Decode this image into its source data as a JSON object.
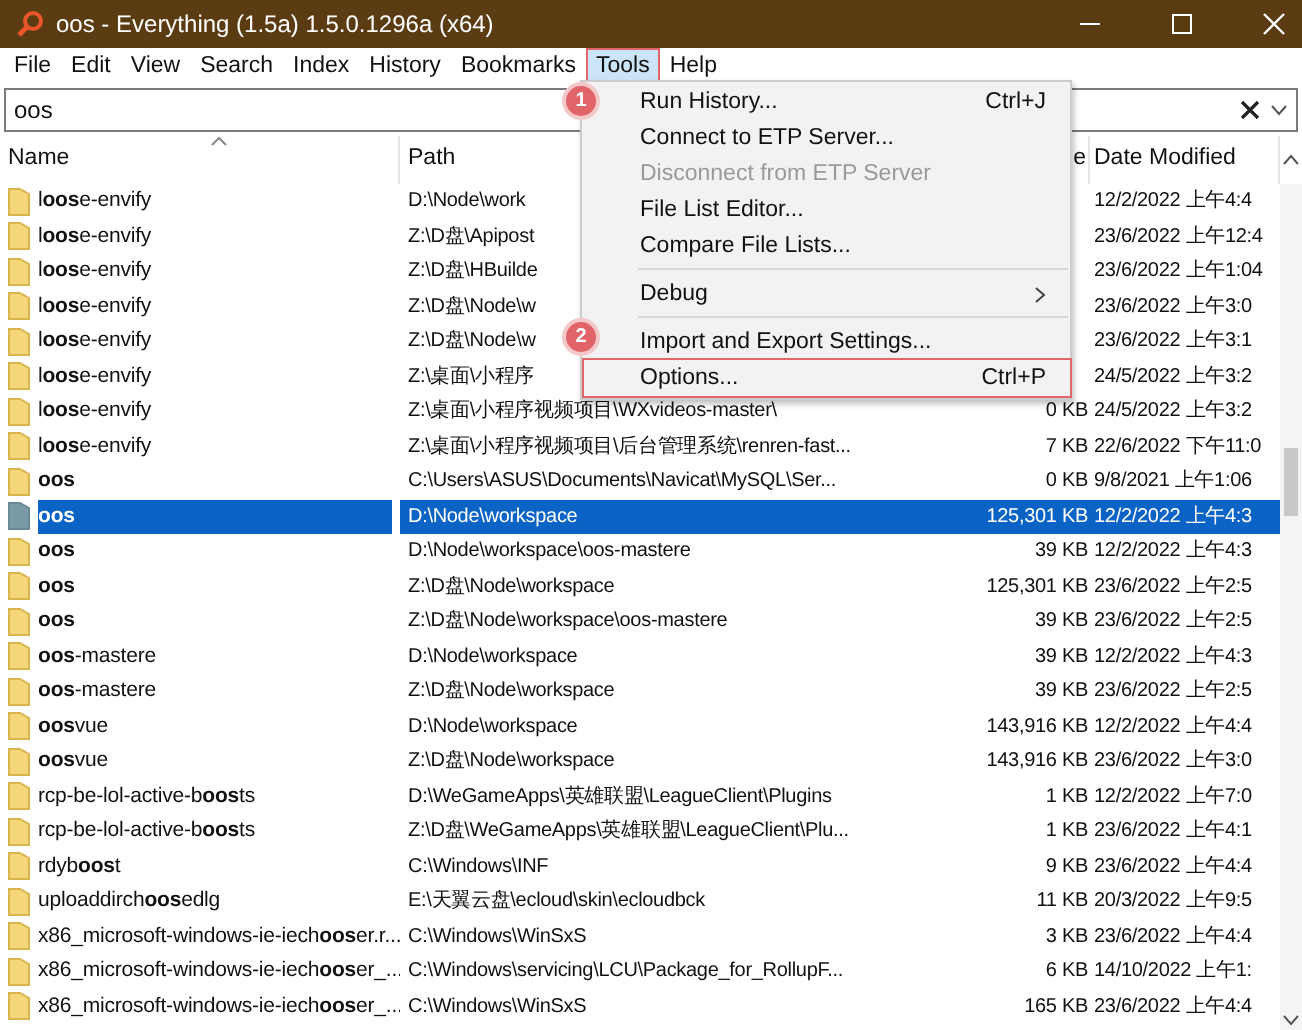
{
  "window": {
    "title": "oos - Everything (1.5a) 1.5.0.1296a (x64)"
  },
  "menu_bar": [
    {
      "label": "File",
      "selected": false
    },
    {
      "label": "Edit",
      "selected": false
    },
    {
      "label": "View",
      "selected": false
    },
    {
      "label": "Search",
      "selected": false
    },
    {
      "label": "Index",
      "selected": false
    },
    {
      "label": "History",
      "selected": false
    },
    {
      "label": "Bookmarks",
      "selected": false
    },
    {
      "label": "Tools",
      "selected": true,
      "highlighted": true
    },
    {
      "label": "Help",
      "selected": false
    }
  ],
  "search": {
    "value": "oos"
  },
  "columns": [
    "Name",
    "Path",
    "e",
    "Date Modified"
  ],
  "rows": [
    {
      "name": "l**oos**e-envify",
      "path": "D:\\Node\\work",
      "size": "",
      "date": "12/2/2022 上午4:4",
      "selected": false
    },
    {
      "name": "l**oos**e-envify",
      "path": "Z:\\D盘\\Apipost",
      "size": "",
      "date": "23/6/2022 上午12:4",
      "selected": false
    },
    {
      "name": "l**oos**e-envify",
      "path": "Z:\\D盘\\HBuilde",
      "size": "",
      "date": "23/6/2022 上午1:04",
      "selected": false
    },
    {
      "name": "l**oos**e-envify",
      "path": "Z:\\D盘\\Node\\w",
      "size": "",
      "date": "23/6/2022 上午3:0",
      "selected": false
    },
    {
      "name": "l**oos**e-envify",
      "path": "Z:\\D盘\\Node\\w",
      "size": "",
      "date": "23/6/2022 上午3:1",
      "selected": false
    },
    {
      "name": "l**oos**e-envify",
      "path": "Z:\\桌面\\小程序",
      "size": "",
      "date": "24/5/2022 上午3:2",
      "selected": false
    },
    {
      "name": "l**oos**e-envify",
      "path": "Z:\\桌面\\小程序视频项目\\WXvideos-master\\",
      "size": "0 KB",
      "date": "24/5/2022 上午3:2",
      "selected": false
    },
    {
      "name": "l**oos**e-envify",
      "path": "Z:\\桌面\\小程序视频项目\\后台管理系统\\renren-fast...",
      "size": "7 KB",
      "date": "22/6/2022 下午11:0",
      "selected": false
    },
    {
      "name": "**oos**",
      "path": "C:\\Users\\ASUS\\Documents\\Navicat\\MySQL\\Ser...",
      "size": "0 KB",
      "date": "9/8/2021 上午1:06",
      "selected": false
    },
    {
      "name": "**oos**",
      "path": "D:\\Node\\workspace",
      "size": "125,301 KB",
      "date": "12/2/2022 上午4:3",
      "selected": true
    },
    {
      "name": "**oos**",
      "path": "D:\\Node\\workspace\\oos-mastere",
      "size": "39 KB",
      "date": "12/2/2022 上午4:3",
      "selected": false
    },
    {
      "name": "**oos**",
      "path": "Z:\\D盘\\Node\\workspace",
      "size": "125,301 KB",
      "date": "23/6/2022 上午2:5",
      "selected": false
    },
    {
      "name": "**oos**",
      "path": "Z:\\D盘\\Node\\workspace\\oos-mastere",
      "size": "39 KB",
      "date": "23/6/2022 上午2:5",
      "selected": false
    },
    {
      "name": "**oos**-mastere",
      "path": "D:\\Node\\workspace",
      "size": "39 KB",
      "date": "12/2/2022 上午4:3",
      "selected": false
    },
    {
      "name": "**oos**-mastere",
      "path": "Z:\\D盘\\Node\\workspace",
      "size": "39 KB",
      "date": "23/6/2022 上午2:5",
      "selected": false
    },
    {
      "name": "**oos**vue",
      "path": "D:\\Node\\workspace",
      "size": "143,916 KB",
      "date": "12/2/2022 上午4:4",
      "selected": false
    },
    {
      "name": "**oos**vue",
      "path": "Z:\\D盘\\Node\\workspace",
      "size": "143,916 KB",
      "date": "23/6/2022 上午3:0",
      "selected": false
    },
    {
      "name": "rcp-be-lol-active-b**oos**ts",
      "path": "D:\\WeGameApps\\英雄联盟\\LeagueClient\\Plugins",
      "size": "1 KB",
      "date": "12/2/2022 上午7:0",
      "selected": false
    },
    {
      "name": "rcp-be-lol-active-b**oos**ts",
      "path": "Z:\\D盘\\WeGameApps\\英雄联盟\\LeagueClient\\Plu...",
      "size": "1 KB",
      "date": "23/6/2022 上午4:1",
      "selected": false
    },
    {
      "name": "rdyb**oos**t",
      "path": "C:\\Windows\\INF",
      "size": "9 KB",
      "date": "23/6/2022 上午4:4",
      "selected": false
    },
    {
      "name": "uploaddirch**oos**edlg",
      "path": "E:\\天翼云盘\\ecloud\\skin\\ecloudbck",
      "size": "11 KB",
      "date": "20/3/2022 上午9:5",
      "selected": false
    },
    {
      "name": "x86_microsoft-windows-ie-iech**oos**er.r...",
      "path": "C:\\Windows\\WinSxS",
      "size": "3 KB",
      "date": "23/6/2022 上午4:4",
      "selected": false
    },
    {
      "name": "x86_microsoft-windows-ie-iech**oos**er_...",
      "path": "C:\\Windows\\servicing\\LCU\\Package_for_RollupF...",
      "size": "6 KB",
      "date": "14/10/2022 上午1:",
      "selected": false
    },
    {
      "name": "x86_microsoft-windows-ie-iech**oos**er_...",
      "path": "C:\\Windows\\WinSxS",
      "size": "165 KB",
      "date": "23/6/2022 上午4:4",
      "selected": false
    }
  ],
  "tools_menu": [
    {
      "kind": "item",
      "label": "Run History...",
      "shortcut": "Ctrl+J",
      "disabled": false
    },
    {
      "kind": "item",
      "label": "Connect to ETP Server...",
      "disabled": false
    },
    {
      "kind": "item",
      "label": "Disconnect from ETP Server",
      "disabled": true
    },
    {
      "kind": "item",
      "label": "File List Editor...",
      "disabled": false
    },
    {
      "kind": "item",
      "label": "Compare File Lists...",
      "disabled": false
    },
    {
      "kind": "separator"
    },
    {
      "kind": "submenu",
      "label": "Debug",
      "disabled": false
    },
    {
      "kind": "separator"
    },
    {
      "kind": "item",
      "label": "Import and Export Settings...",
      "disabled": false
    },
    {
      "kind": "item",
      "label": "Options...",
      "shortcut": "Ctrl+P",
      "disabled": false,
      "highlighted": true
    }
  ],
  "annotations": [
    {
      "label": "1"
    },
    {
      "label": "2"
    }
  ]
}
